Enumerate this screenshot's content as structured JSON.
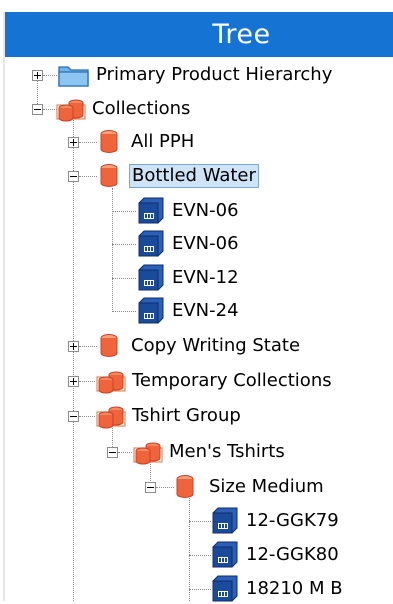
{
  "panel": {
    "title": "Tree"
  },
  "tree": {
    "nodes": [
      {
        "label": "Primary Product Hierarchy",
        "icon": "folder-icon",
        "toggle": "expand"
      },
      {
        "label": "Collections",
        "icon": "collections-icon",
        "toggle": "collapse"
      },
      {
        "label": "All PPH",
        "icon": "collection-icon",
        "toggle": "expand"
      },
      {
        "label": "Bottled Water",
        "icon": "collection-icon",
        "toggle": "collapse",
        "selected": true
      },
      {
        "label": "EVN-06",
        "icon": "product-icon"
      },
      {
        "label": "EVN-06",
        "icon": "product-icon"
      },
      {
        "label": "EVN-12",
        "icon": "product-icon"
      },
      {
        "label": "EVN-24",
        "icon": "product-icon"
      },
      {
        "label": "Copy Writing State",
        "icon": "collection-icon",
        "toggle": "expand"
      },
      {
        "label": "Temporary Collections",
        "icon": "collections-icon",
        "toggle": "expand"
      },
      {
        "label": "Tshirt Group",
        "icon": "collections-icon",
        "toggle": "collapse"
      },
      {
        "label": "Men's Tshirts",
        "icon": "collections-icon",
        "toggle": "collapse"
      },
      {
        "label": "Size Medium",
        "icon": "collection-icon",
        "toggle": "collapse"
      },
      {
        "label": "12-GGK79",
        "icon": "product-icon"
      },
      {
        "label": "12-GGK80",
        "icon": "product-icon"
      },
      {
        "label": "18210 M B",
        "icon": "product-icon"
      }
    ]
  },
  "colors": {
    "header": "#1573d3",
    "selection": "#cfe3f7",
    "collection": "#f0643c",
    "product": "#1a4a9a",
    "folder": "#5aa7e8"
  }
}
